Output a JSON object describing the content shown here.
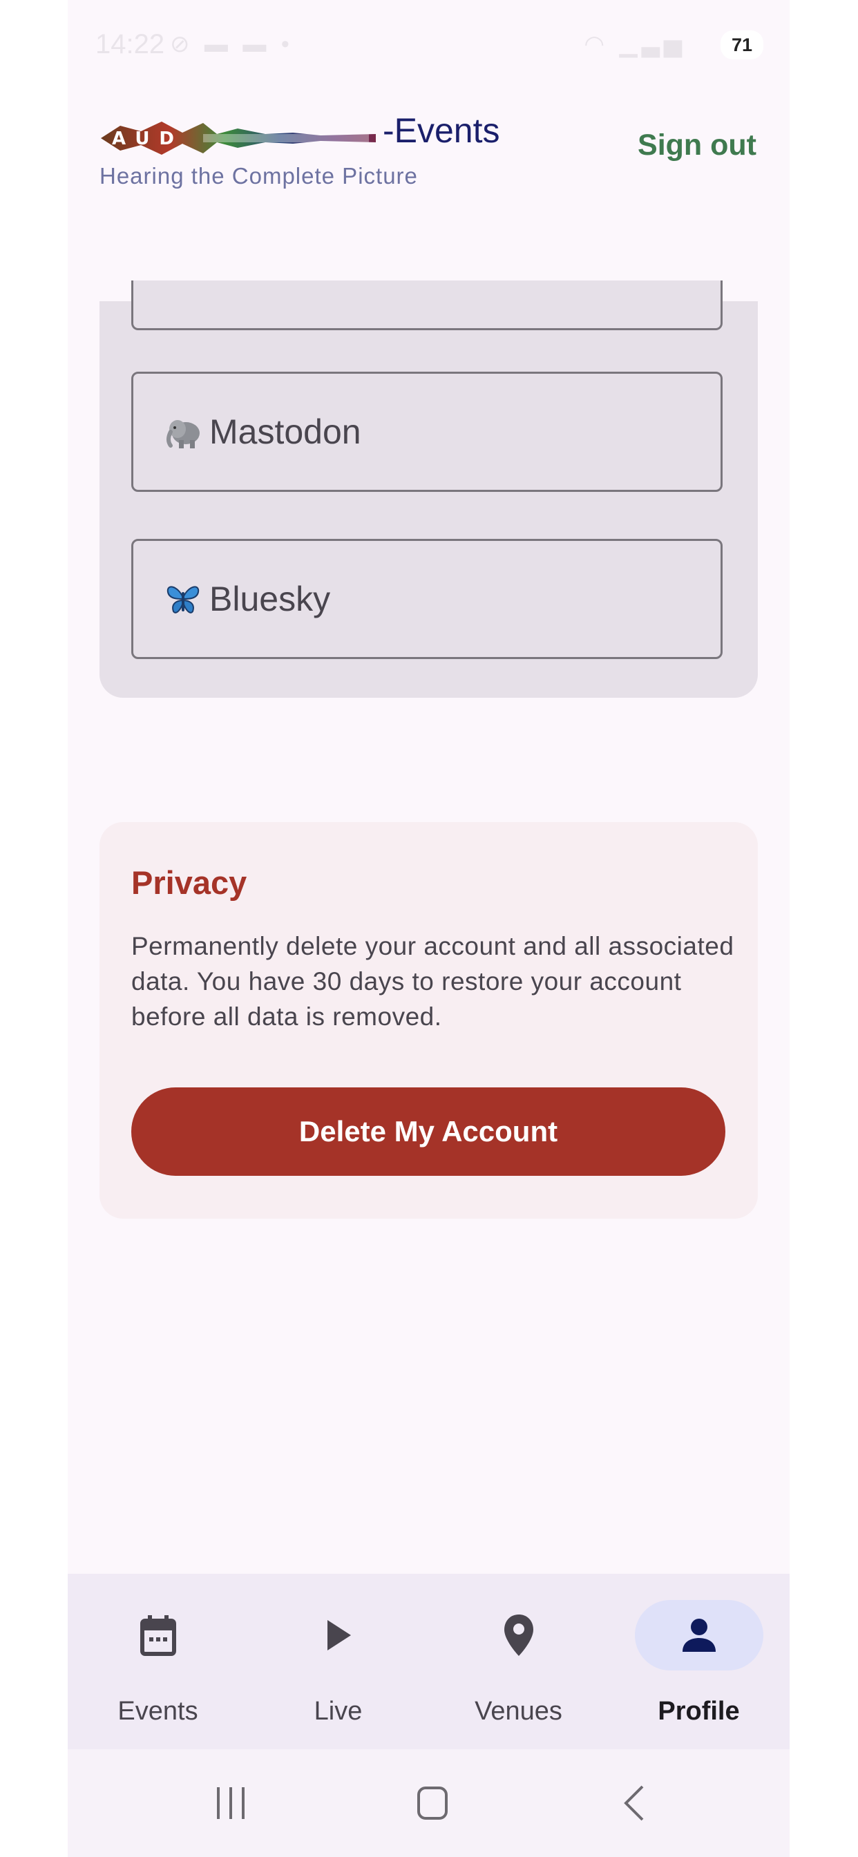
{
  "status_bar": {
    "time": "14:22",
    "battery": "71",
    "left_icons": [
      "data-saver-icon",
      "gallery-icon",
      "gallery-icon",
      "dot-icon"
    ],
    "right_icons": [
      "wifi-icon",
      "signal-icon"
    ]
  },
  "header": {
    "logo_text": "AUD",
    "brand_suffix": "-Events",
    "tagline": "Hearing the Complete Picture",
    "sign_out_label": "Sign out"
  },
  "social": {
    "buttons": [
      {
        "emoji_icon": "elephant-icon",
        "label": "Mastodon"
      },
      {
        "emoji_icon": "butterfly-icon",
        "label": "Bluesky"
      }
    ]
  },
  "privacy": {
    "title": "Privacy",
    "description": "Permanently delete your account and all associated data. You have 30 days to restore your account before all data is removed.",
    "delete_button_label": "Delete My Account"
  },
  "bottom_nav": {
    "items": [
      {
        "label": "Events",
        "icon": "calendar-icon",
        "active": false
      },
      {
        "label": "Live",
        "icon": "play-icon",
        "active": false
      },
      {
        "label": "Venues",
        "icon": "map-pin-icon",
        "active": false
      },
      {
        "label": "Profile",
        "icon": "person-icon",
        "active": true
      }
    ]
  },
  "colors": {
    "accent_red": "#a53328",
    "sign_out_green": "#3f7a4f",
    "brand_navy": "#1a1f6b",
    "active_nav_pill": "#dfe1f9"
  }
}
